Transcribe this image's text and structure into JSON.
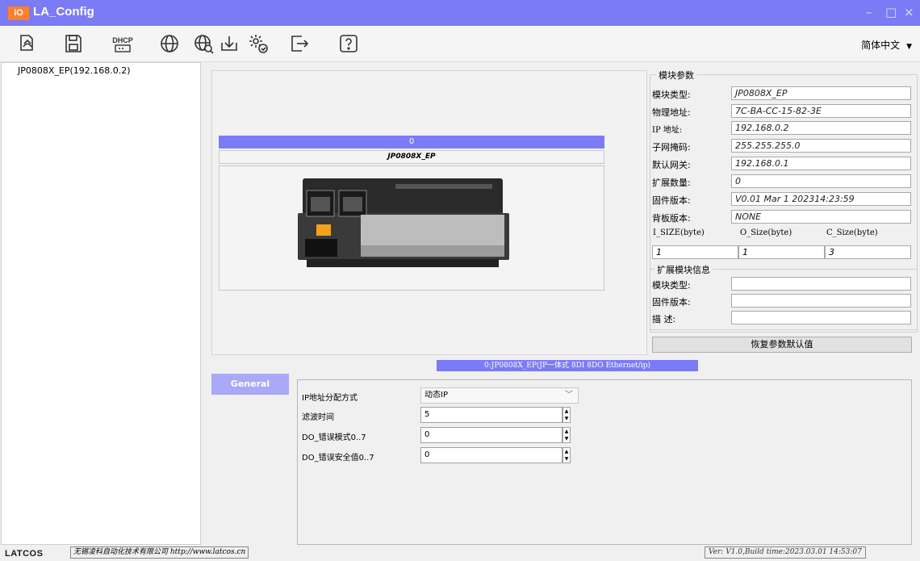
{
  "window": {
    "logo": "IO",
    "title": "LA_Config",
    "minimize": "–",
    "maximize": "□",
    "close": "×"
  },
  "toolbar": {
    "dhcp_label": "DHCP",
    "language": "简体中文",
    "icons": [
      "search-device-icon",
      "save-icon",
      "dhcp-icon",
      "network-globe-icon",
      "download-icon",
      "settings-icon",
      "import-icon",
      "help-icon"
    ]
  },
  "tree": {
    "device": "JP0808X_EP(192.168.0.2)"
  },
  "device_view": {
    "slot_index": "0",
    "module_name": "JP0808X_EP"
  },
  "params": {
    "legend": "模块参数",
    "rows": [
      {
        "label": "模块类型:",
        "value": "JP0808X_EP"
      },
      {
        "label": "物理地址:",
        "value": "7C-BA-CC-15-82-3E"
      },
      {
        "label": " IP 地址:",
        "value": "192.168.0.2"
      },
      {
        "label": "子网掩码:",
        "value": "255.255.255.0"
      },
      {
        "label": "默认网关:",
        "value": "192.168.0.1"
      },
      {
        "label": "扩展数量:",
        "value": "0"
      },
      {
        "label": "固件版本:",
        "value": "V0.01 Mar  1 202314:23:59"
      },
      {
        "label": "背板版本:",
        "value": "NONE"
      }
    ],
    "size_headers": [
      "I_SIZE(byte)",
      "O_Size(byte)",
      "C_Size(byte)"
    ],
    "size_values": [
      "1",
      "1",
      "3"
    ],
    "ext_legend": "扩展模块信息",
    "ext_rows": [
      {
        "label": "模块类型:",
        "value": ""
      },
      {
        "label": "固件版本:",
        "value": ""
      },
      {
        "label": "描    述:",
        "value": ""
      }
    ],
    "restore_button": "恢复参数默认值"
  },
  "module_status": "0:JP0808X_EP(JP一体式 8DI 8DO Ethernet/ip)",
  "tabs": {
    "general": "General"
  },
  "settings": [
    {
      "label": "IP地址分配方式",
      "value": "动态IP",
      "type": "select"
    },
    {
      "label": "滤波时间",
      "value": "5",
      "type": "spin"
    },
    {
      "label": "DO_错误模式0..7",
      "value": "0",
      "type": "spin"
    },
    {
      "label": "DO_错误安全值0..7",
      "value": "0",
      "type": "spin"
    }
  ],
  "footer": {
    "logo": "LATCOS",
    "company": "无锡凌科自动化技术有限公司 http://www.latcos.cn",
    "version": "Ver: V1.0,Build time:2023.03.01 14:53:07"
  },
  "colors": {
    "title_bar": "#7b7bf5",
    "accent": "#7b7bf5",
    "tab": "#a9a9f7",
    "logo_orange": "#ff7f2a"
  }
}
